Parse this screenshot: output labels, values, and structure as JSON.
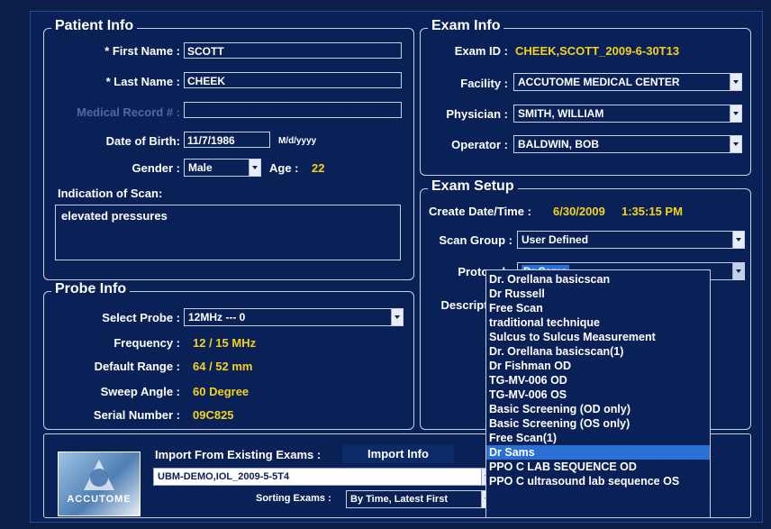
{
  "patient": {
    "legend": "Patient Info",
    "first_name_label": "* First Name :",
    "first_name": "SCOTT",
    "last_name_label": "* Last Name :",
    "last_name": "CHEEK",
    "mrn_label": "Medical Record # :",
    "mrn": "",
    "dob_label": "Date of Birth:",
    "dob": "11/7/1986",
    "dob_hint": "M/d/yyyy",
    "gender_label": "Gender :",
    "gender": "Male",
    "age_label": "Age :",
    "age": "22",
    "indication_label": "Indication of Scan:",
    "indication": "elevated pressures"
  },
  "probe": {
    "legend": "Probe Info",
    "select_label": "Select Probe :",
    "select_value": "12MHz --- 0",
    "frequency_label": "Frequency :",
    "frequency": "12 / 15 MHz",
    "range_label": "Default Range :",
    "range": "64 / 52 mm",
    "sweep_label": "Sweep Angle :",
    "sweep": "60 Degree",
    "serial_label": "Serial Number :",
    "serial": "09C825"
  },
  "exam": {
    "legend": "Exam Info",
    "id_label": "Exam ID :",
    "id": "CHEEK,SCOTT_2009-6-30T13",
    "facility_label": "Facility :",
    "facility": "ACCUTOME MEDICAL CENTER",
    "physician_label": "Physician :",
    "physician": "SMITH, WILLIAM",
    "operator_label": "Operator :",
    "operator": "BALDWIN, BOB"
  },
  "setup": {
    "legend": "Exam Setup",
    "create_label": "Create Date/Time :",
    "create_date": "6/30/2009",
    "create_time": "1:35:15 PM",
    "scan_group_label": "Scan Group :",
    "scan_group": "User Defined",
    "protocol_label": "Protocol :",
    "protocol": "Dr Sams",
    "description_label": "Description :"
  },
  "protocol_options": [
    "Dr. Orellana basicscan",
    "Dr Russell",
    "Free Scan",
    "traditional technique",
    "Sulcus to Sulcus Measurement",
    "Dr. Orellana basicscan(1)",
    "Dr Fishman OD",
    "TG-MV-006 OD",
    "TG-MV-006 OS",
    "Basic Screening (OD only)",
    "Basic Screening (OS only)",
    "Free Scan(1)",
    "Dr Sams",
    "PPO C LAB SEQUENCE  OD",
    "PPO C ultrasound lab sequence OS"
  ],
  "protocol_selected_index": 12,
  "import": {
    "label": "Import From Existing Exams :",
    "button": "Import Info",
    "exam_value": "UBM-DEMO,IOL_2009-5-5T4",
    "sorting_label": "Sorting Exams :",
    "sorting_value": "By Time, Latest First"
  },
  "logo": {
    "text": "ACCUTOME"
  },
  "colors": {
    "accent_yellow": "#f5d21a",
    "selection_blue": "#2a6fd6",
    "panel": "#0a2158"
  }
}
